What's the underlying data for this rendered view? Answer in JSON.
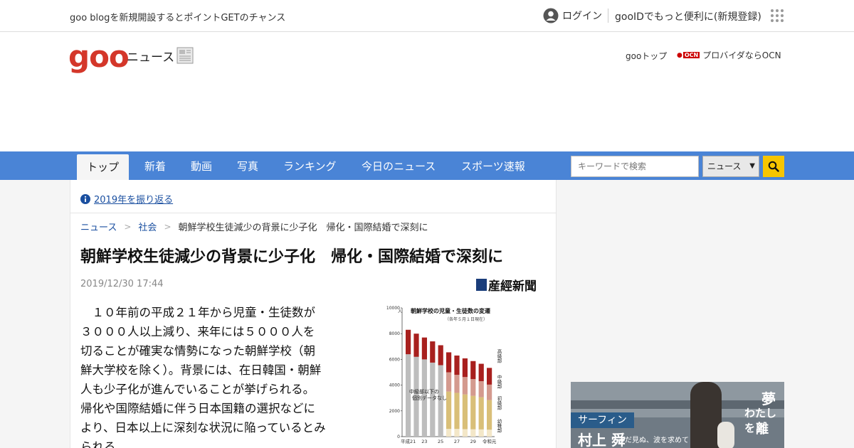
{
  "topbar": {
    "promo": "goo blogを新規開設するとポイントGETのチャンス",
    "login": "ログイン",
    "register": "gooIDでもっと便利に(新規登録)"
  },
  "header": {
    "logo": "goo",
    "logo_sub": "ニュース",
    "goo_top": "gooトップ",
    "ocn_label": "プロバイダならOCN",
    "ocn_badge": "OCN"
  },
  "nav": {
    "tabs": [
      {
        "label": "トップ",
        "active": true
      },
      {
        "label": "新着"
      },
      {
        "label": "動画"
      },
      {
        "label": "写真"
      },
      {
        "label": "ランキング"
      },
      {
        "label": "今日のニュース"
      },
      {
        "label": "スポーツ速報"
      }
    ],
    "search_placeholder": "キーワードで検索",
    "search_scope": "ニュース"
  },
  "article": {
    "review_link": "2019年を振り返る",
    "breadcrumb": [
      "ニュース",
      "社会",
      "朝鮮学校生徒減少の背景に少子化　帰化・国際結婚で深刻に"
    ],
    "title": "朝鮮学校生徒減少の背景に少子化　帰化・国際結婚で深刻に",
    "date": "2019/12/30 17:44",
    "source": "産經新聞",
    "body": "　１０年前の平成２１年から児童・生徒数が３０００人以上減り、来年には５０００人を切ることが確実な情勢になった朝鮮学校（朝鮮大学校を除く）。背景には、在日韓国・朝鮮人も少子化が進んでいることが挙げられる。帰化や国際結婚に伴う日本国籍の選択などにより、日本以上に深刻な状況に陥っているとみられる。"
  },
  "chart_data": {
    "type": "bar",
    "title": "朝鮮学校の児童・生徒数の変遷",
    "subtitle": "（各年５月１日現在）",
    "ylabel": "人",
    "ylim": [
      0,
      10000
    ],
    "yticks": [
      0,
      2000,
      4000,
      6000,
      8000,
      10000
    ],
    "categories": [
      "H21",
      "H22",
      "H23",
      "H24",
      "H25",
      "H26",
      "H27",
      "H28",
      "H29",
      "H30",
      "R1"
    ],
    "xtick_labels": [
      "平成21",
      "23",
      "25",
      "27",
      "29",
      "令和元"
    ],
    "annotation": "中級部以下の個別データなし",
    "series": [
      {
        "name": "幼稚部",
        "color": "#f3e7c8",
        "values": [
          null,
          null,
          null,
          null,
          null,
          600,
          600,
          580,
          570,
          560,
          540
        ]
      },
      {
        "name": "初級部",
        "color": "#d9bf78",
        "values": [
          null,
          null,
          null,
          null,
          null,
          2900,
          2800,
          2700,
          2600,
          2500,
          2300
        ]
      },
      {
        "name": "中級部",
        "color": "#d49a8e",
        "values": [
          null,
          null,
          null,
          null,
          null,
          1500,
          1400,
          1350,
          1300,
          1250,
          1200
        ]
      },
      {
        "name": "高級部",
        "color": "#a8201e",
        "values": [
          1900,
          1800,
          1700,
          1650,
          1550,
          1550,
          1500,
          1450,
          1400,
          1350,
          1300
        ]
      }
    ],
    "pre_detail_totals": [
      6400,
      6200,
      6000,
      5750,
      5550
    ]
  },
  "sidebar": {
    "label": "サーフィン",
    "name": "村上 舜",
    "sub": "まだ見ぬ、波を求めて",
    "dream": "夢",
    "dream2": "わたしを",
    "dream3": "離"
  },
  "colors": {
    "nav": "#4a84d6",
    "logo": "#d4372a",
    "link": "#1a4fa0",
    "search_button": "#f7c500"
  }
}
